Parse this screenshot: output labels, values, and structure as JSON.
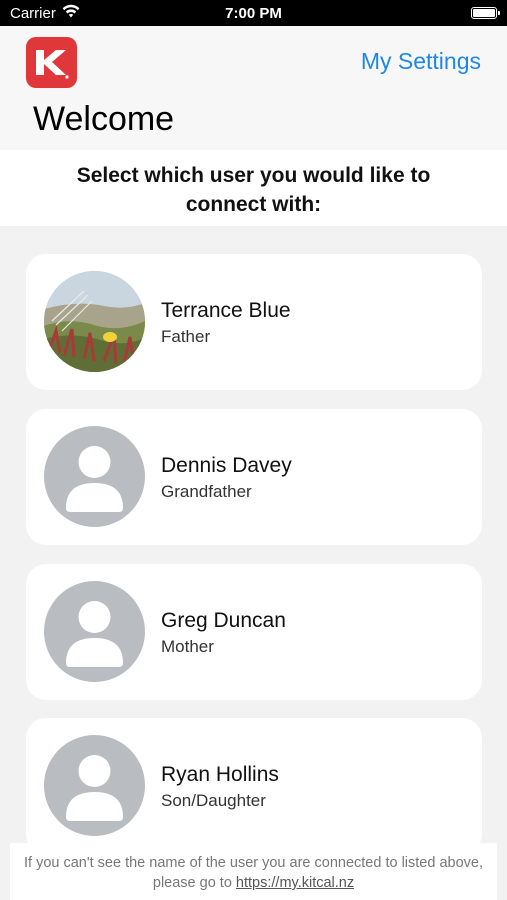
{
  "status_bar": {
    "carrier": "Carrier",
    "time": "7:00 PM"
  },
  "header": {
    "logo_letter": "K",
    "settings_label": "My Settings",
    "title": "Welcome"
  },
  "prompt": "Select which user you would like to connect with:",
  "users": [
    {
      "name": "Terrance Blue",
      "role": "Father",
      "avatar": "photo"
    },
    {
      "name": "Dennis Davey",
      "role": "Grandfather",
      "avatar": "placeholder"
    },
    {
      "name": "Greg Duncan",
      "role": "Mother",
      "avatar": "placeholder"
    },
    {
      "name": "Ryan Hollins",
      "role": "Son/Daughter",
      "avatar": "placeholder"
    }
  ],
  "footer": {
    "text": "If you can't see the name of the user you are connected to listed above, please go to",
    "link": "https://my.kitcal.nz"
  },
  "colors": {
    "accent": "#1e88e5",
    "logo": "#e0373b",
    "placeholder_avatar": "#b9bcc1"
  }
}
